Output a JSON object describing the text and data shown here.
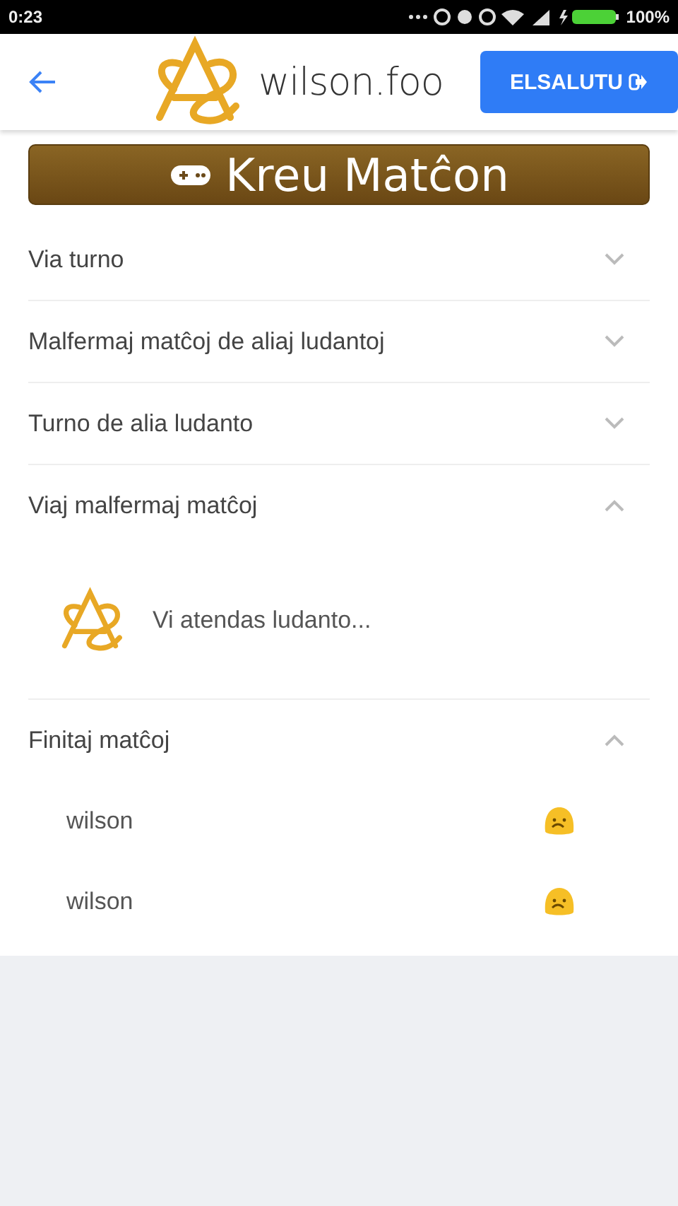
{
  "status_bar": {
    "time": "0:23",
    "battery": "100%"
  },
  "header": {
    "site": "wilson.foo",
    "logout_button": "ELSALUTU"
  },
  "banner": {
    "label": "Kreu Matĉon"
  },
  "sections": [
    {
      "title": "Via turno",
      "expanded": false
    },
    {
      "title": "Malfermaj matĉoj de aliaj ludantoj",
      "expanded": false
    },
    {
      "title": "Turno de alia ludanto",
      "expanded": false
    },
    {
      "title": "Viaj malfermaj matĉoj",
      "expanded": true,
      "kind": "waiting",
      "message": "Vi atendas ludanto..."
    },
    {
      "title": "Finitaj matĉoj",
      "expanded": true,
      "kind": "matches",
      "rows": [
        {
          "player": "wilson",
          "won": false
        },
        {
          "player": "wilson",
          "won": false
        }
      ]
    }
  ]
}
